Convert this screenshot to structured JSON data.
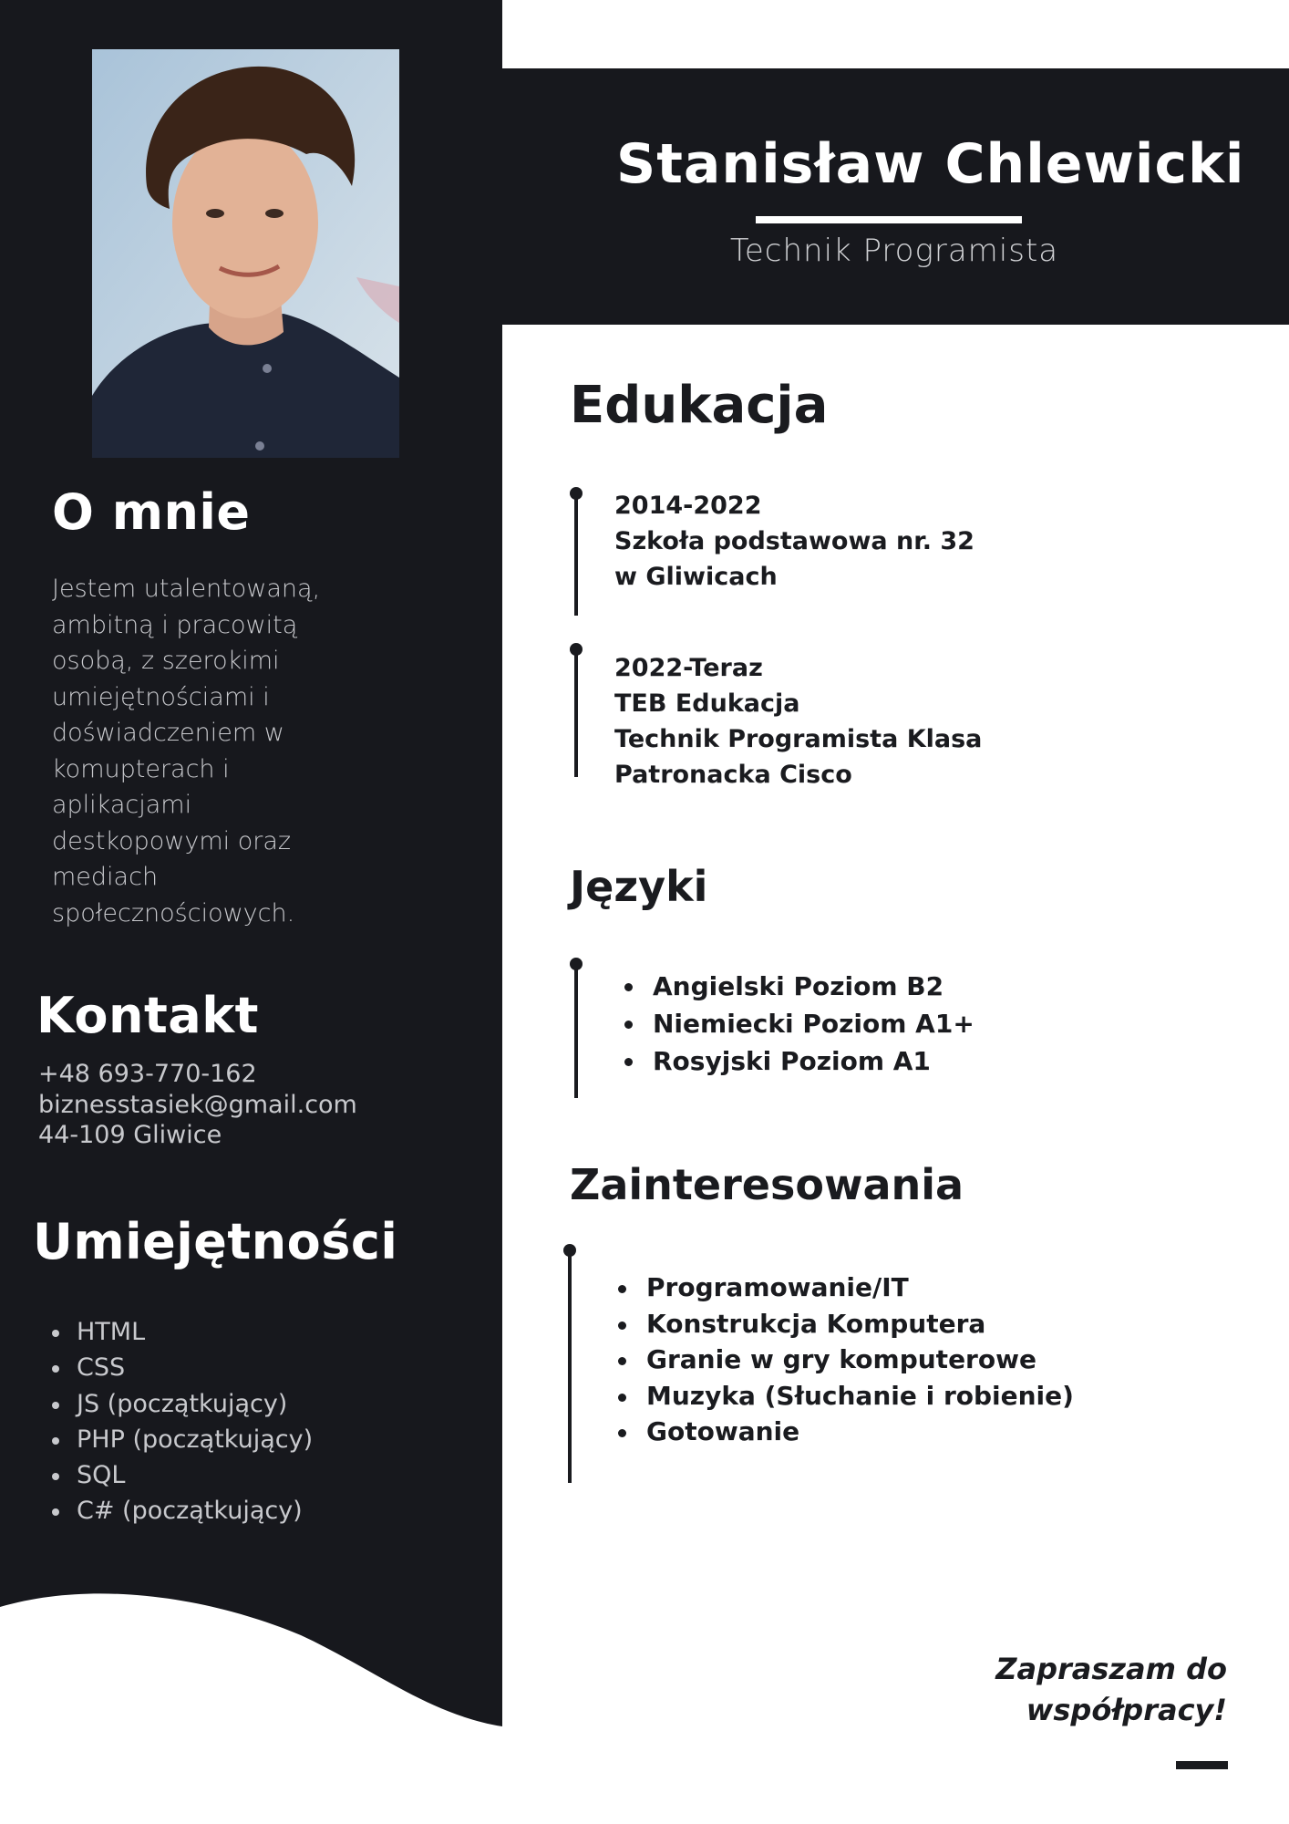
{
  "person": {
    "name": "Stanisław Chlewicki",
    "job_title": "Technik Programista"
  },
  "about": {
    "title": "O mnie",
    "text": "Jestem utalentowaną, ambitną i pracowitą osobą, z szerokimi umiejętnościami i doświadczeniem w komupterach i aplikacjami destkopowymi oraz mediach społecznościowych."
  },
  "contact": {
    "title": "Kontakt",
    "phone": "+48 693-770-162",
    "email": "biznesstasiek@gmail.com",
    "address": "44-109 Gliwice"
  },
  "skills": {
    "title": "Umiejętności",
    "items": [
      "HTML",
      "CSS",
      "JS (początkujący)",
      "PHP (początkujący)",
      "SQL",
      "C# (początkujący)"
    ]
  },
  "education": {
    "title": "Edukacja",
    "entries": [
      {
        "years": "2014-2022",
        "line1": "Szkoła podstawowa nr. 32",
        "line2": "w Gliwicach"
      },
      {
        "years": "2022-Teraz",
        "line1": "TEB Edukacja",
        "line2": "Technik Programista Klasa",
        "line3": "Patronacka Cisco"
      }
    ]
  },
  "languages": {
    "title": "Języki",
    "items": [
      "Angielski Poziom B2",
      "Niemiecki Poziom A1+",
      "Rosyjski Poziom A1"
    ]
  },
  "interests": {
    "title": "Zainteresowania",
    "items": [
      "Programowanie/IT",
      "Konstrukcja Komputera",
      "Granie w gry komputerowe",
      "Muzyka (Słuchanie i robienie)",
      "Gotowanie"
    ]
  },
  "closing": {
    "line1": "Zapraszam do",
    "line2": "współpracy!"
  },
  "colors": {
    "dark": "#17181d",
    "light_text": "#c8c9cd",
    "white": "#ffffff"
  }
}
